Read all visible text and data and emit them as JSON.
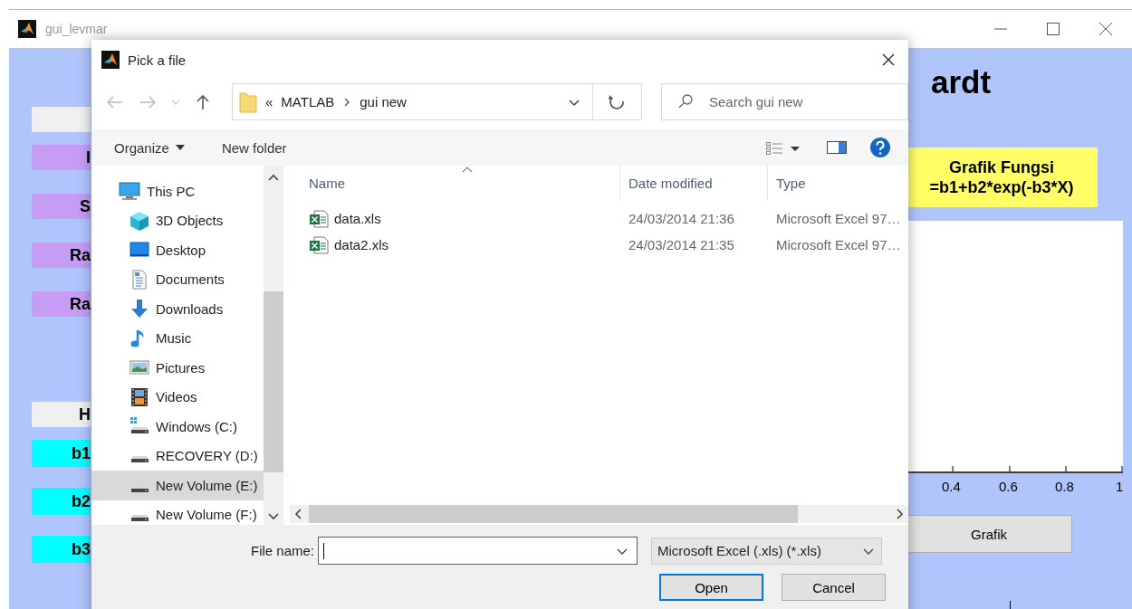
{
  "window": {
    "title": "gui_levmar"
  },
  "left_labels": [
    {
      "kind": "header"
    },
    {
      "kind": "input",
      "text": "I"
    },
    {
      "kind": "input",
      "text": "S"
    },
    {
      "kind": "input",
      "text": "Ra"
    },
    {
      "kind": "input",
      "text": "Ra"
    },
    {
      "kind": "header",
      "text": "H"
    },
    {
      "kind": "output",
      "text": "b1"
    },
    {
      "kind": "output",
      "text": "b2"
    },
    {
      "kind": "output",
      "text": "b3"
    }
  ],
  "heading": "ardt",
  "function_box": {
    "lines": [
      "Grafik Fungsi",
      "=b1+b2*exp(-b3*X)"
    ]
  },
  "axes": {
    "xtick_labels": [
      "0.4",
      "0.6",
      "0.8",
      "1"
    ]
  },
  "grafik_button": "Grafik",
  "dialog": {
    "title": "Pick a file",
    "address": {
      "overflow_mark": "«",
      "segments": [
        "MATLAB",
        "gui new"
      ]
    },
    "search": {
      "placeholder": "Search gui new"
    },
    "toolbar": [
      {
        "label": "Organize",
        "menu": true
      },
      {
        "label": "New folder",
        "menu": false
      }
    ],
    "nav_tree": [
      {
        "label": "This PC",
        "selected": false,
        "children": [
          {
            "label": "3D Objects",
            "selected": false
          },
          {
            "label": "Desktop",
            "selected": false
          },
          {
            "label": "Documents",
            "selected": false
          },
          {
            "label": "Downloads",
            "selected": false
          },
          {
            "label": "Music",
            "selected": false
          },
          {
            "label": "Pictures",
            "selected": false
          },
          {
            "label": "Videos",
            "selected": false
          },
          {
            "label": "Windows (C:)",
            "selected": false
          },
          {
            "label": "RECOVERY (D:)",
            "selected": false
          },
          {
            "label": "New Volume (E:)",
            "selected": true
          },
          {
            "label": "New Volume (F:)",
            "selected": false
          }
        ]
      }
    ],
    "columns": [
      {
        "label": "Name",
        "sorted": true
      },
      {
        "label": "Date modified",
        "sorted": false
      },
      {
        "label": "Type",
        "sorted": false
      }
    ],
    "files": [
      {
        "name": "data.xls",
        "date": "24/03/2014 21:36",
        "type": "Microsoft Excel 97…"
      },
      {
        "name": "data2.xls",
        "date": "24/03/2014 21:35",
        "type": "Microsoft Excel 97…"
      }
    ],
    "file_name": {
      "label": "File name:",
      "focused": true
    },
    "filter": "Microsoft Excel (.xls) (*.xls)",
    "buttons": [
      {
        "label": "Open",
        "default": true
      },
      {
        "label": "Cancel",
        "default": false
      }
    ]
  }
}
